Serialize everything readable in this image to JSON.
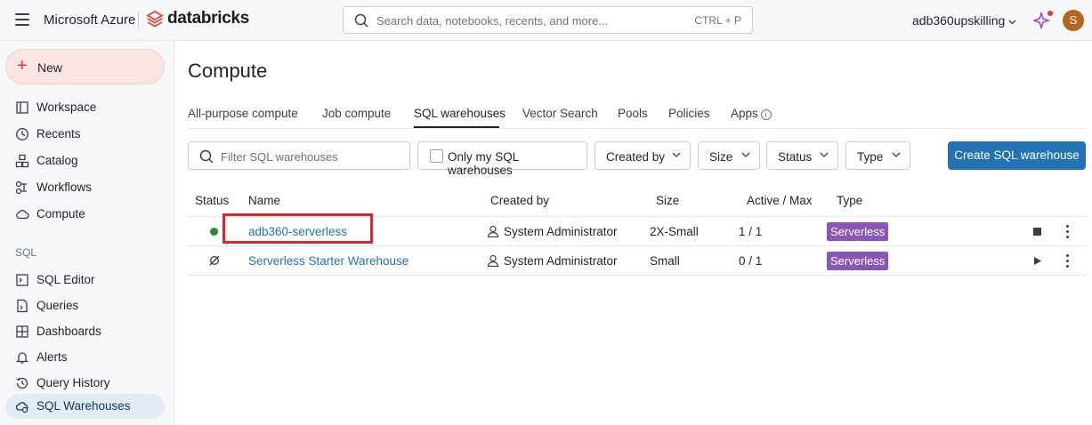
{
  "header": {
    "brand_ms": "Microsoft Azure",
    "brand_db": "databricks",
    "search_placeholder": "Search data, notebooks, recents, and more...",
    "search_shortcut": "CTRL + P",
    "workspace_name": "adb360upskilling",
    "avatar_initial": "S"
  },
  "sidebar": {
    "new_label": "New",
    "items": [
      {
        "label": "Workspace",
        "icon": "workspace-icon"
      },
      {
        "label": "Recents",
        "icon": "clock-icon"
      },
      {
        "label": "Catalog",
        "icon": "catalog-icon"
      },
      {
        "label": "Workflows",
        "icon": "workflows-icon"
      },
      {
        "label": "Compute",
        "icon": "cloud-icon"
      }
    ],
    "sql_section_label": "SQL",
    "sql_items": [
      {
        "label": "SQL Editor",
        "icon": "sql-editor-icon"
      },
      {
        "label": "Queries",
        "icon": "queries-icon"
      },
      {
        "label": "Dashboards",
        "icon": "dashboards-icon"
      },
      {
        "label": "Alerts",
        "icon": "bell-icon"
      },
      {
        "label": "Query History",
        "icon": "history-icon"
      },
      {
        "label": "SQL Warehouses",
        "icon": "warehouse-icon"
      }
    ]
  },
  "main": {
    "title": "Compute",
    "tabs": [
      "All-purpose compute",
      "Job compute",
      "SQL warehouses",
      "Vector Search",
      "Pools",
      "Policies",
      "Apps"
    ],
    "active_tab": "SQL warehouses",
    "filter_placeholder": "Filter SQL warehouses",
    "only_mine_label": "Only my SQL warehouses",
    "dropdowns": [
      "Created by",
      "Size",
      "Status",
      "Type"
    ],
    "create_button": "Create SQL warehouse",
    "table": {
      "columns": [
        "Status",
        "Name",
        "Created by",
        "Size",
        "Active / Max",
        "Type"
      ],
      "rows": [
        {
          "status": "running",
          "name": "adb360-serverless",
          "created_by": "System Administrator",
          "size": "2X-Small",
          "active": "1",
          "max": "1",
          "type": "Serverless",
          "action": "stop"
        },
        {
          "status": "stopped",
          "name": "Serverless Starter Warehouse",
          "created_by": "System Administrator",
          "size": "Small",
          "active": "0",
          "max": "1",
          "type": "Serverless",
          "action": "start"
        }
      ]
    }
  },
  "colors": {
    "accent": "#2272b4",
    "badge": "#8c56b8",
    "running": "#2a8a3a",
    "highlight": "#d9262b"
  }
}
